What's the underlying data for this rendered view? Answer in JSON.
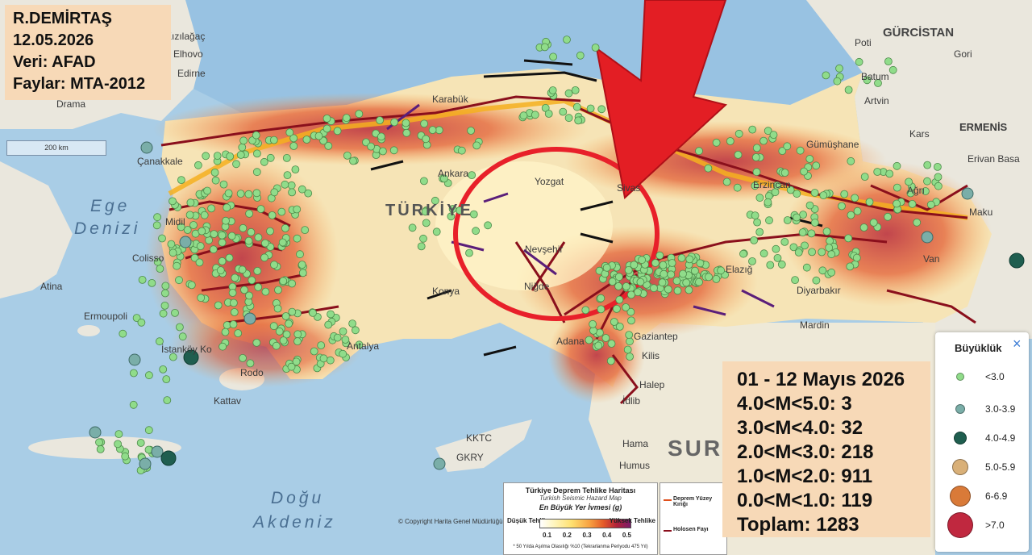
{
  "info_box": {
    "author": "R.DEMİRTAŞ",
    "date": "12.05.2026",
    "data_source": "Veri: AFAD",
    "faults_source": "Faylar: MTA-2012"
  },
  "summary": {
    "period": "01 - 12 Mayıs 2026",
    "rows": [
      "4.0<M<5.0: 3",
      "3.0<M<4.0: 32",
      "2.0<M<3.0: 218",
      "1.0<M<2.0: 911",
      "0.0<M<1.0: 119"
    ],
    "total": "Toplam: 1283"
  },
  "legend": {
    "title": "Büyüklük",
    "close_symbol": "×",
    "items": [
      {
        "label": "<3.0",
        "color": "#90dc8a"
      },
      {
        "label": "3.0-3.9",
        "color": "#7aaea8"
      },
      {
        "label": "4.0-4.9",
        "color": "#1f5e4f"
      },
      {
        "label": "5.0-5.9",
        "color": "#d9b078"
      },
      {
        "label": "6-6.9",
        "color": "#d97a38"
      },
      {
        "label": ">7.0",
        "color": "#c0283f"
      }
    ]
  },
  "scale_bar": "200 km",
  "hazard_legend": {
    "title": "Türkiye Deprem Tehlike Haritası",
    "subtitle": "Turkish Seismic Hazard Map",
    "heading": "En Büyük Yer İvmesi (g)",
    "low": "Düşük Tehlike",
    "high": "Yüksek Tehlike",
    "ticks": [
      "0.1",
      "0.2",
      "0.3",
      "0.4",
      "0.5"
    ],
    "note": "* 50 Yılda Aşılma Olasılığı %10 (Tekrarlanma Periyodu 475 Yıl)"
  },
  "fault_legend": {
    "items": [
      "Deprem Yüzey Kırığı",
      "Holosen Fayı"
    ]
  },
  "copyright": "© Copyright Harita Genel Müdürlüğü",
  "places": {
    "country_main": "TÜRKİYE",
    "country_syria": "SUR",
    "georgia": "GÜRCİSTAN",
    "armenia": "ERMENİS",
    "aegean_1": "Ege",
    "aegean_2": "Denizi",
    "med_1": "Doğu",
    "med_2": "Akdeniz",
    "cities": [
      "Karabük",
      "Ankara",
      "Yozgat",
      "Sivas",
      "Nevşehir",
      "Niğde",
      "Konya",
      "Adana",
      "Antalya",
      "Gaziantep",
      "Kilis",
      "Halep",
      "İdlib",
      "Hama",
      "Humus",
      "Elazığ",
      "Diyarbakır",
      "Mardin",
      "Erzincan",
      "Ağrı",
      "Kars",
      "Gümüşhane",
      "Batum",
      "Artvin",
      "Gori",
      "Poti",
      "Maku",
      "Erivan Basa",
      "Atina",
      "Ermoupoli",
      "İstanköy Ko",
      "Rodo",
      "Kattav",
      "Çanakkale",
      "KKTC",
      "GKRY",
      "Van",
      "Edirne",
      "Elhovo",
      "Kızılağaç",
      "Drama",
      "Midil",
      "Colisso"
    ]
  },
  "chart_data": {
    "type": "map",
    "title": "01 - 12 Mayıs 2026",
    "magnitude_bins": [
      {
        "range": "4.0<M<5.0",
        "count": 3
      },
      {
        "range": "3.0<M<4.0",
        "count": 32
      },
      {
        "range": "2.0<M<3.0",
        "count": 218
      },
      {
        "range": "1.0<M<2.0",
        "count": 911
      },
      {
        "range": "0.0<M<1.0",
        "count": 119
      }
    ],
    "total": 1283
  }
}
